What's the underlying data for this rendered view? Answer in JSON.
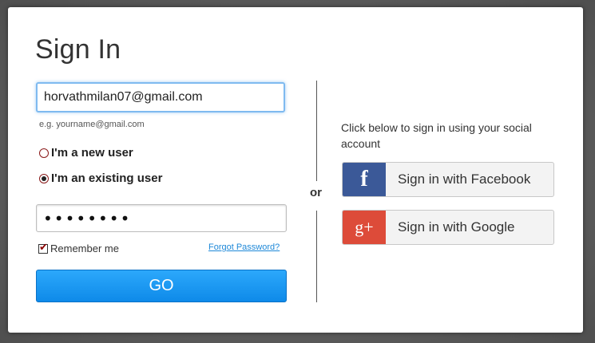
{
  "title": "Sign In",
  "email": {
    "value": "horvathmilan07@gmail.com",
    "hint": "e.g. yourname@gmail.com"
  },
  "user_type": {
    "options": [
      {
        "label": "I'm a new user",
        "selected": false
      },
      {
        "label": "I'm an existing user",
        "selected": true
      }
    ]
  },
  "password": {
    "masked_value": "••••••••"
  },
  "remember": {
    "label": "Remember me",
    "checked": true
  },
  "forgot_label": "Forgot Password?",
  "go_label": "GO",
  "or_label": "or",
  "social": {
    "intro": "Click below to sign in using your social account",
    "facebook": {
      "icon": "facebook-icon",
      "glyph": "f",
      "label": "Sign in with Facebook",
      "color": "#3b5998"
    },
    "google": {
      "icon": "google-plus-icon",
      "glyph": "g+",
      "label": "Sign in with Google",
      "color": "#dd4b39"
    }
  },
  "colors": {
    "accent": "#1e9cf5",
    "link": "#1e88d8"
  }
}
